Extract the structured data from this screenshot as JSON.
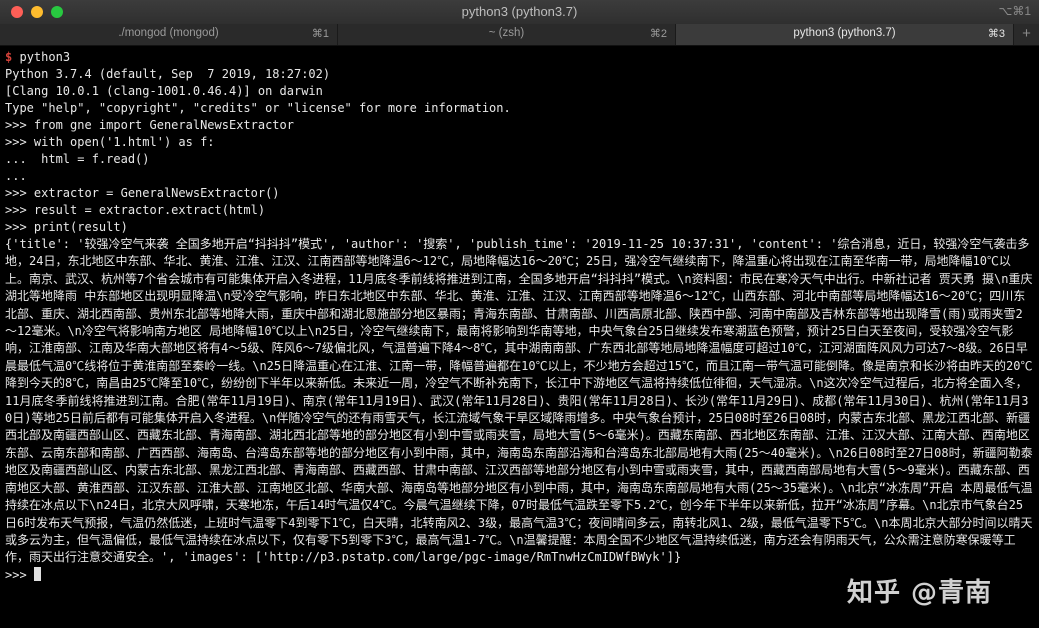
{
  "window": {
    "title": "python3 (python3.7)",
    "shortcut": "⌥⌘1"
  },
  "tabs": [
    {
      "label": "./mongod (mongod)",
      "key": "⌘1",
      "active": false
    },
    {
      "label": "~ (zsh)",
      "key": "⌘2",
      "active": false
    },
    {
      "label": "python3 (python3.7)",
      "key": "⌘3",
      "active": true
    }
  ],
  "tab_add": "+",
  "terminal": {
    "shell_prompt": "$",
    "command": "python3",
    "lines": [
      "Python 3.7.4 (default, Sep  7 2019, 18:27:02)",
      "[Clang 10.0.1 (clang-1001.0.46.4)] on darwin",
      "Type \"help\", \"copyright\", \"credits\" or \"license\" for more information.",
      ">>> from gne import GeneralNewsExtractor",
      ">>> with open('1.html') as f:",
      "...  html = f.read()",
      "...",
      ">>> extractor = GeneralNewsExtractor()",
      ">>> result = extractor.extract(html)",
      ">>> print(result)"
    ],
    "output": "{'title': '较强冷空气来袭 全国多地开启“抖抖抖”模式', 'author': '搜索', 'publish_time': '2019-11-25 10:37:31', 'content': '综合消息，近日，较强冷空气袭击多地，24日，东北地区中东部、华北、黄淮、江淮、江汉、江南西部等地降温6～12℃，局地降幅达16～20℃；25日，强冷空气继续南下，降温重心将出现在江南至华南一带，局地降幅10℃以上。南京、武汉、杭州等7个省会城市有可能集体开启入冬进程，11月底冬季前线将推进到江南，全国多地开启“抖抖抖”模式。\\n资料图：市民在寒冷天气中出行。中新社记者 贾天勇 摄\\n重庆湖北等地降雨 中东部地区出现明显降温\\n受冷空气影响，昨日东北地区中东部、华北、黄淮、江淮、江汉、江南西部等地降温6～12℃，山西东部、河北中南部等局地降幅达16～20℃；四川东北部、重庆、湖北西南部、贵州东北部等地降大雨，重庆中部和湖北恩施部分地区暴雨；青海东南部、甘肃南部、川西高原北部、陕西中部、河南中南部及吉林东部等地出现降雪(雨)或雨夹雪2～12毫米。\\n冷空气将影响南方地区 局地降幅10℃以上\\n25日，冷空气继续南下，最南将影响到华南等地，中央气象台25日继续发布寒潮蓝色预警，预计25日白天至夜间，受较强冷空气影响，江淮南部、江南及华南大部地区将有4～5级、阵风6～7级偏北风，气温普遍下降4～8℃，其中湖南南部、广东西北部等地局地降温幅度可超过10℃，江河湖面阵风风力可达7～8级。26日早晨最低气温0℃线将位于黄淮南部至秦岭一线。\\n25日降温重心在江淮、江南一带，降幅普遍都在10℃以上，不少地方会超过15℃，而且江南一带气温可能倒降。像是南京和长沙将由昨天的20℃降到今天的8℃，南昌由25℃降至10℃，纷纷创下半年以来新低。未来近一周，冷空气不断补充南下，长江中下游地区气温将持续低位徘徊，天气湿凉。\\n这次冷空气过程后，北方将全面入冬，11月底冬季前线将推进到江南。合肥(常年11月19日)、南京(常年11月19日)、武汉(常年11月28日)、贵阳(常年11月28日)、长沙(常年11月29日)、成都(常年11月30日)、杭州(常年11月30日)等地25日前后都有可能集体开启入冬进程。\\n伴随冷空气的还有雨雪天气，长江流域气象干旱区域降雨增多。中央气象台预计，25日08时至26日08时，内蒙古东北部、黑龙江西北部、新疆西北部及南疆西部山区、西藏东北部、青海南部、湖北西北部等地的部分地区有小到中雪或雨夹雪，局地大雪(5～6毫米)。西藏东南部、西北地区东南部、江淮、江汉大部、江南大部、西南地区东部、云南东部和南部、广西西部、海南岛、台湾岛东部等地的部分地区有小到中雨，其中，海南岛东南部沿海和台湾岛东北部局地有大雨(25～40毫米)。\\n26日08时至27日08时，新疆阿勒泰地区及南疆西部山区、内蒙古东北部、黑龙江西北部、青海南部、西藏西部、甘肃中南部、江汉西部等地部分地区有小到中雪或雨夹雪，其中，西藏西南部局地有大雪(5～9毫米)。西藏东部、西南地区大部、黄淮西部、江汉东部、江淮大部、江南地区北部、华南大部、海南岛等地部分地区有小到中雨，其中，海南岛东南部局地有大雨(25～35毫米)。\\n北京“冰冻周”开启 本周最低气温持续在冰点以下\\n24日，北京大风呼啸，天寒地冻，午后14时气温仅4℃。今晨气温继续下降，07时最低气温跌至零下5.2℃，创今年下半年以来新低，拉开“冰冻周”序幕。\\n北京市气象台25日6时发布天气预报，气温仍然低迷，上班时气温零下4到零下1℃，白天晴，北转南风2、3级，最高气温3℃；夜间晴间多云，南转北风1、2级，最低气温零下5℃。\\n本周北京大部分时间以晴天或多云为主，但气温偏低，最低气温持续在冰点以下，仅有零下5到零下3℃，最高气温1-7℃。\\n温馨提醒：本周全国不少地区气温持续低迷，南方还会有阴雨天气，公众需注意防寒保暖等工作，雨天出行注意交通安全。', 'images': ['http://p3.pstatp.com/large/pgc-image/RmTnwHzCmIDWfBWyk']}",
    "final_prompt": ">>> "
  },
  "watermark": "知乎 @青南"
}
